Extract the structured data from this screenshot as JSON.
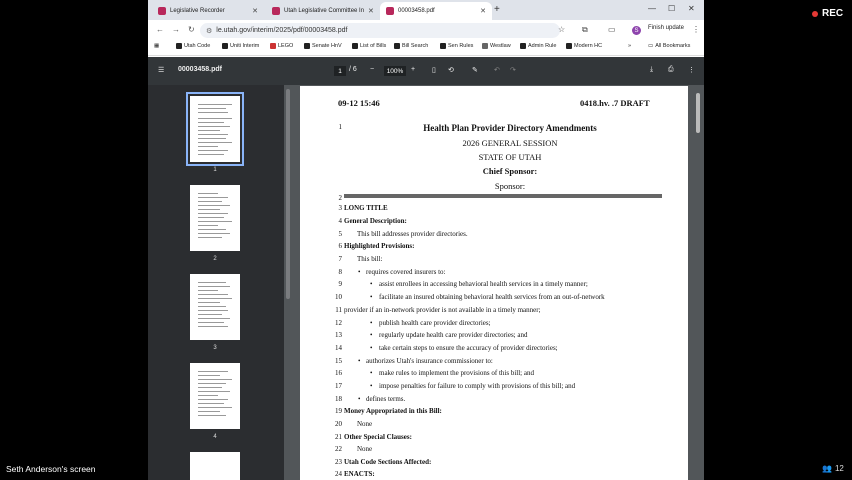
{
  "recording": {
    "label": "REC",
    "participant_count": "12"
  },
  "share_label": "Seth Anderson's screen",
  "tabs": [
    {
      "title": "Legislative Recorder",
      "active": false
    },
    {
      "title": "Utah Legislative Committee In",
      "active": false
    },
    {
      "title": "00003458.pdf",
      "active": true
    }
  ],
  "address": {
    "url": "le.utah.gov/interim/2025/pdf/00003458.pdf"
  },
  "profile": {
    "initial": "S",
    "finish_update": "Finish update"
  },
  "bookmarks": [
    "Utah Code",
    "Uniti Interim",
    "LEGO",
    "Senate HnV",
    "List of Bills",
    "Bill Search",
    "Sen Rules",
    "Westlaw",
    "Admin Rule",
    "Modern HC"
  ],
  "all_bookmarks": "All Bookmarks",
  "pdf": {
    "filename": "00003458.pdf",
    "page_current": "1",
    "page_total": "/ 6",
    "zoom": "100%"
  },
  "thumbnails": [
    "1",
    "2",
    "3",
    "4"
  ],
  "document": {
    "date": "09-12 15:46",
    "draft": "0418.hv. .7 DRAFT",
    "title": "Health Plan Provider Directory Amendments",
    "session": "2026 GENERAL SESSION",
    "state": "STATE OF UTAH",
    "chief_sponsor": "Chief Sponsor:",
    "sponsor": "Sponsor:",
    "lines": [
      {
        "n": "1",
        "text": ""
      },
      {
        "n": "2",
        "text": ""
      },
      {
        "n": "3",
        "text": "LONG TITLE"
      },
      {
        "n": "4",
        "text": "General Description:"
      },
      {
        "n": "5",
        "text": "This bill addresses provider directories."
      },
      {
        "n": "6",
        "text": "Highlighted Provisions:"
      },
      {
        "n": "7",
        "text": "This bill:"
      },
      {
        "n": "8",
        "text": "requires covered insurers to:"
      },
      {
        "n": "9",
        "text": "assist enrollees in accessing behavioral health services in a timely manner;"
      },
      {
        "n": "10",
        "text": "facilitate an insured obtaining behavioral health services from an out-of-network"
      },
      {
        "n": "11",
        "text": "provider if an in-network provider is not available in a timely manner;"
      },
      {
        "n": "12",
        "text": "publish health care provider directories;"
      },
      {
        "n": "13",
        "text": "regularly update health care provider directories; and"
      },
      {
        "n": "14",
        "text": "take certain steps to ensure the accuracy of provider directories;"
      },
      {
        "n": "15",
        "text": "authorizes Utah's insurance commissioner to:"
      },
      {
        "n": "16",
        "text": "make rules to implement the provisions of this bill; and"
      },
      {
        "n": "17",
        "text": "impose penalties for failure to comply with provisions of this bill; and"
      },
      {
        "n": "18",
        "text": "defines terms."
      },
      {
        "n": "19",
        "text": "Money Appropriated in this Bill:"
      },
      {
        "n": "20",
        "text": "None"
      },
      {
        "n": "21",
        "text": "Other Special Clauses:"
      },
      {
        "n": "22",
        "text": "None"
      },
      {
        "n": "23",
        "text": "Utah Code Sections Affected:"
      },
      {
        "n": "24",
        "text": "ENACTS:"
      }
    ]
  }
}
